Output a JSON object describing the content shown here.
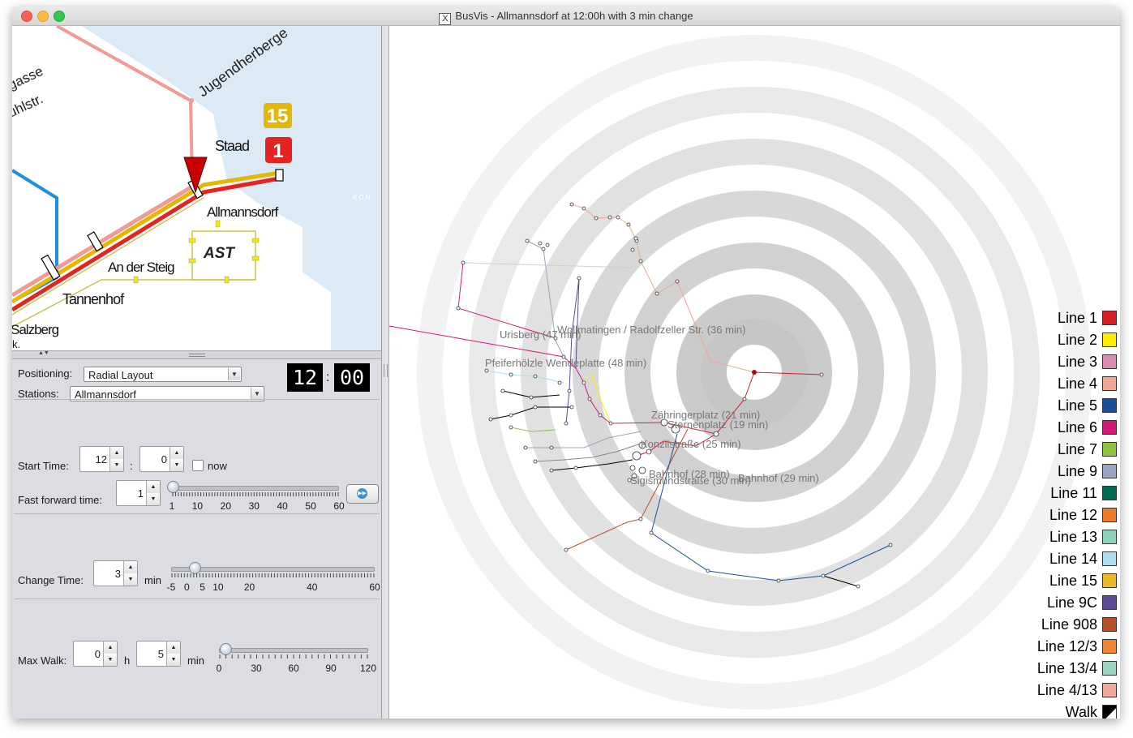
{
  "window": {
    "title": "BusVis - Allmannsdorf at 12:00h with 3 min change",
    "x_icon": "X"
  },
  "map": {
    "labels": {
      "jugendherberge": "Jugendherberge",
      "gasse": "gasse",
      "uhlstr": "uhlstr.",
      "staad": "Staad",
      "allmannsdorf": "Allmannsdorf",
      "an_der_steig": "An der Steig",
      "tannenhof": "Tannenhof",
      "salzberg": "Salzberg",
      "ast": "AST",
      "kon": "KON",
      "k_fragment": "k."
    },
    "badges": {
      "line15": "15",
      "line1": "1"
    },
    "colors": {
      "water": "#dceaf6",
      "line1": "#e52421",
      "line15": "#e3b800",
      "line4": "#f29a94",
      "line5": "#1d8fdc"
    }
  },
  "controls": {
    "positioning_label": "Positioning:",
    "positioning_value": "Radial Layout",
    "stations_label": "Stations:",
    "stations_value": "Allmannsdorf",
    "clock_hours": "12",
    "clock_sep": ":",
    "clock_minutes": "00",
    "start_time_label": "Start Time:",
    "start_hour": "12",
    "start_colon": ":",
    "start_minute": "0",
    "now_label": "now",
    "fast_forward_label": "Fast forward time:",
    "fast_forward_value": "1",
    "ff_ticks": [
      "1",
      "10",
      "20",
      "30",
      "40",
      "50",
      "60"
    ],
    "fast_forward_level": 1,
    "change_time_label": "Change Time:",
    "change_time_value": "3",
    "change_unit": "min",
    "change_ticks": [
      "-5",
      "0",
      "5",
      "10",
      "20",
      "40",
      "60"
    ],
    "change_time_level": 3,
    "max_walk_label": "Max Walk:",
    "max_walk_hours": "0",
    "max_walk_h_unit": "h",
    "max_walk_minutes": "5",
    "max_walk_min_unit": "min",
    "walk_ticks": [
      "0",
      "30",
      "60",
      "90",
      "120"
    ],
    "max_walk_level": 5
  },
  "radial": {
    "station_labels": [
      "Urisberg (47 min)",
      "Wollmatingen / Radolfzeller Str. (36 min)",
      "Pfeiferhölzle Wendeplatte (48 min)",
      "Zähringerplatz (21 min)",
      "Sternenplatz (19 min)",
      "Konzilstraße (25 min)",
      "Bahnhof (28 min)",
      "Sigismundstraße (30 min)",
      "Bahnhof (29 min)"
    ]
  },
  "legend": [
    {
      "name": "Line 1",
      "color": "#d81f26"
    },
    {
      "name": "Line 2",
      "color": "#ffee00"
    },
    {
      "name": "Line 3",
      "color": "#d98cb3"
    },
    {
      "name": "Line 4",
      "color": "#f2a595"
    },
    {
      "name": "Line 5",
      "color": "#1a4f95"
    },
    {
      "name": "Line 6",
      "color": "#d3187a"
    },
    {
      "name": "Line 7",
      "color": "#8dc13f"
    },
    {
      "name": "Line 9",
      "color": "#9aa3bf"
    },
    {
      "name": "Line 11",
      "color": "#006b55"
    },
    {
      "name": "Line 12",
      "color": "#e97d2a"
    },
    {
      "name": "Line 13",
      "color": "#8fd0b8"
    },
    {
      "name": "Line 14",
      "color": "#aedcf0"
    },
    {
      "name": "Line 15",
      "color": "#e9b82a"
    },
    {
      "name": "Line 9C",
      "color": "#5c4a97"
    },
    {
      "name": "Line 908",
      "color": "#b4502a"
    },
    {
      "name": "Line 12/3",
      "color": "#ee8533"
    },
    {
      "name": "Line 13/4",
      "color": "#9dd2be"
    },
    {
      "name": "Line 4/13",
      "color": "#f0a89a"
    },
    {
      "name": "Walk",
      "color": "#000000"
    }
  ]
}
